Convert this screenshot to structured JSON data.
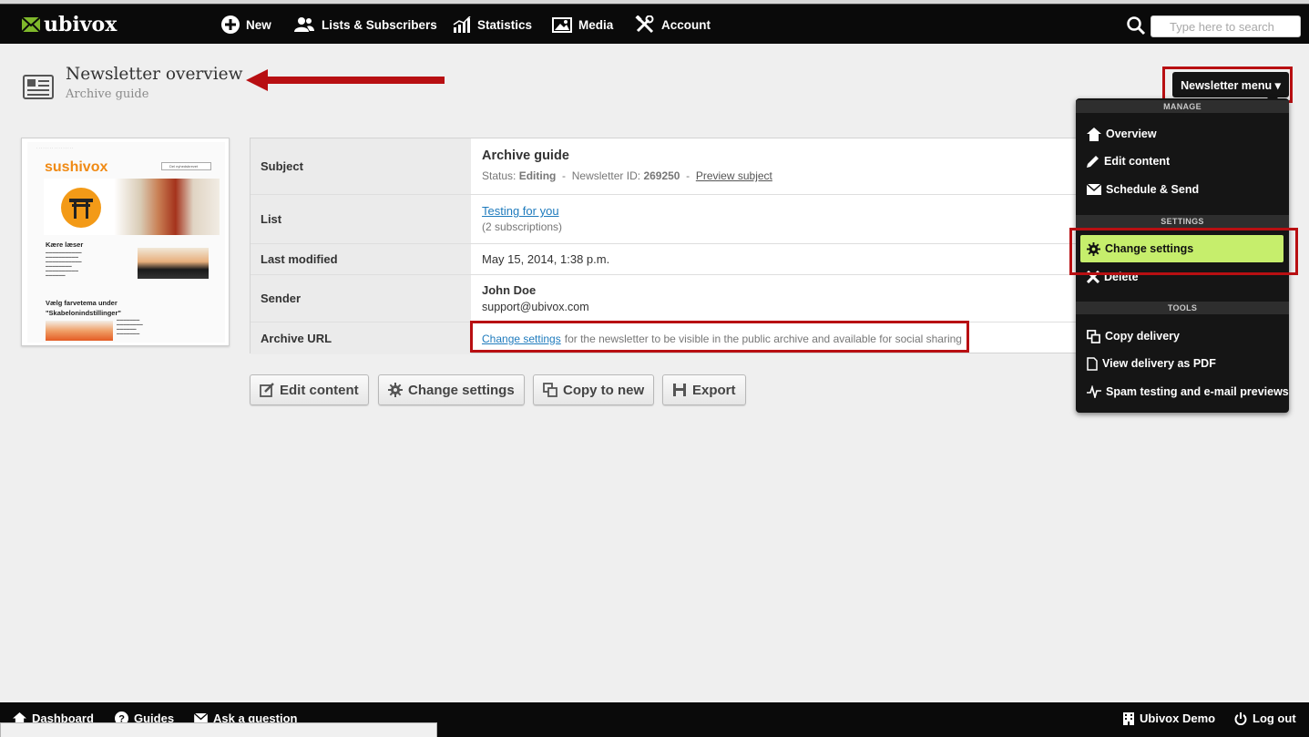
{
  "app": {
    "brand": "ubivox"
  },
  "nav": {
    "items": [
      {
        "label": "New",
        "icon": "plus-circle-icon"
      },
      {
        "label": "Lists & Subscribers",
        "icon": "users-icon"
      },
      {
        "label": "Statistics",
        "icon": "bar-chart-icon"
      },
      {
        "label": "Media",
        "icon": "picture-icon"
      },
      {
        "label": "Account",
        "icon": "tools-icon"
      }
    ],
    "search_placeholder": "Type here to search"
  },
  "page": {
    "title": "Newsletter overview",
    "subtitle": "Archive guide"
  },
  "thumbnail": {
    "brand": "sushivox",
    "subscribe_button": "Del nyhedsbrevet",
    "heading_1": "Kære læser",
    "heading_2": "Vælg farvetema under \"Skabelonindstillinger\""
  },
  "details": {
    "subject_label": "Subject",
    "subject_value": "Archive guide",
    "status_prefix": "Status:",
    "status_value": "Editing",
    "newsletter_id_prefix": "Newsletter ID:",
    "newsletter_id": "269250",
    "preview_subject_link": "Preview subject",
    "list_label": "List",
    "list_value": "Testing for you",
    "list_count": "(2 subscriptions)",
    "last_modified_label": "Last modified",
    "last_modified_value": "May 15, 2014, 1:38 p.m.",
    "sender_label": "Sender",
    "sender_name": "John Doe",
    "sender_email": "support@ubivox.com",
    "archive_url_label": "Archive URL",
    "archive_change_link": "Change settings",
    "archive_note": "for the newsletter to be visible in the public archive and available for social sharing"
  },
  "actions": {
    "edit_content": "Edit content",
    "change_settings": "Change settings",
    "copy_to_new": "Copy to new",
    "export": "Export"
  },
  "newsletter_menu": {
    "button_label": "Newsletter menu ▾",
    "sections": {
      "manage": "MANAGE",
      "settings": "SETTINGS",
      "tools": "TOOLS"
    },
    "manage_items": [
      "Overview",
      "Edit content",
      "Schedule & Send"
    ],
    "settings_items": [
      "Change settings",
      "Delete"
    ],
    "tools_items": [
      "Copy delivery",
      "View delivery as PDF",
      "Spam testing and e-mail previews"
    ]
  },
  "footer": {
    "dashboard": "Dashboard",
    "guides": "Guides",
    "ask": "Ask a question",
    "account_name": "Ubivox Demo",
    "logout": "Log out"
  },
  "annotation_color": "#b80f12",
  "highlight_color": "#c6ee6c"
}
